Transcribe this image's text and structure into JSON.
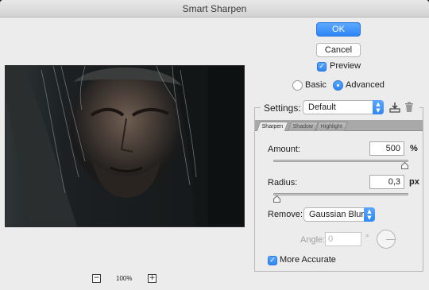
{
  "window": {
    "title": "Smart Sharpen"
  },
  "buttons": {
    "ok": "OK",
    "cancel": "Cancel"
  },
  "preview": {
    "label": "Preview",
    "checked": true
  },
  "mode": {
    "basic": "Basic",
    "advanced": "Advanced",
    "selected": "Advanced"
  },
  "settings": {
    "label": "Settings:",
    "value": "Default",
    "save_icon": "save-preset-icon",
    "delete_icon": "trash-icon"
  },
  "tabs": [
    {
      "label": "Sharpen",
      "active": true
    },
    {
      "label": "Shadow",
      "active": false
    },
    {
      "label": "Highlight",
      "active": false
    }
  ],
  "amount": {
    "label": "Amount:",
    "value": "500",
    "unit": "%",
    "level": 1.0
  },
  "radius": {
    "label": "Radius:",
    "value": "0,3",
    "unit": "px",
    "level": 0.0
  },
  "remove": {
    "label": "Remove:",
    "value": "Gaussian Blur"
  },
  "angle": {
    "label": "Angle:",
    "value": "0",
    "unit": "°"
  },
  "more_accurate": {
    "label": "More Accurate",
    "checked": true
  },
  "zoom": {
    "level": "100%",
    "minus_icon": "zoom-out-icon",
    "plus_icon": "zoom-in-icon"
  },
  "colors": {
    "accent": "#2f86f6",
    "dialog_bg": "#ececec"
  }
}
